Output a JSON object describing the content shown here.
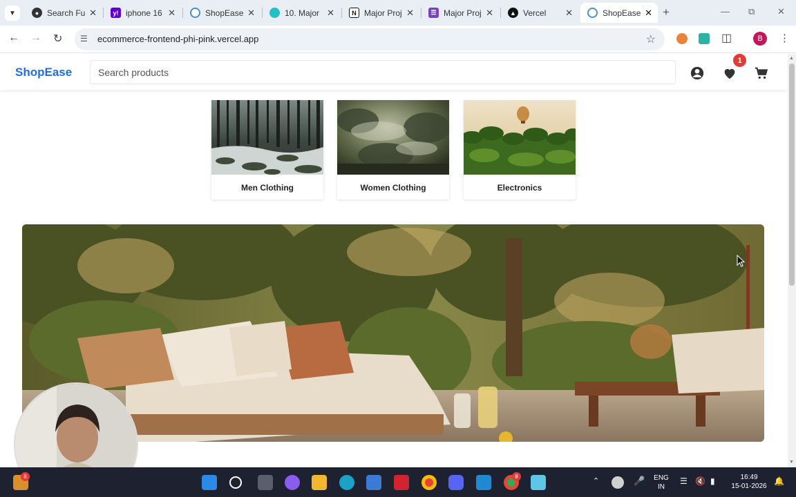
{
  "browser": {
    "tabs": [
      {
        "title": "Search Fun",
        "favicon": "search-favicon",
        "active": false
      },
      {
        "title": "iphone 16",
        "favicon": "yahoo-favicon",
        "active": false
      },
      {
        "title": "ShopEase",
        "favicon": "shopease-favicon",
        "active": false
      },
      {
        "title": "10. Major",
        "favicon": "app-favicon",
        "active": false
      },
      {
        "title": "Major Proj",
        "favicon": "notion-favicon",
        "active": false
      },
      {
        "title": "Major Proj",
        "favicon": "onenote-favicon",
        "active": false
      },
      {
        "title": "Vercel",
        "favicon": "vercel-favicon",
        "active": false
      },
      {
        "title": "ShopEase",
        "favicon": "shopease-favicon",
        "active": true
      }
    ],
    "url": "ecommerce-frontend-phi-pink.vercel.app",
    "profile_initial": "B"
  },
  "header": {
    "logo": "ShopEase",
    "search_placeholder": "Search products",
    "wishlist_count": "1"
  },
  "categories": [
    {
      "label": "Men Clothing",
      "image": "snowy-forest"
    },
    {
      "label": "Women Clothing",
      "image": "misty-trees"
    },
    {
      "label": "Electronics",
      "image": "palm-grove-balloon"
    }
  ],
  "banner": {
    "image": "outdoor-patio-sofa"
  },
  "taskbar": {
    "widget_badge": "8",
    "chrome_badge": "8",
    "lang_top": "ENG",
    "lang_bottom": "IN",
    "time": "16:49",
    "date": "15-01-2026"
  },
  "colors": {
    "brand": "#1e6fd9",
    "badge": "#e53935",
    "taskbar": "#1e2230"
  }
}
